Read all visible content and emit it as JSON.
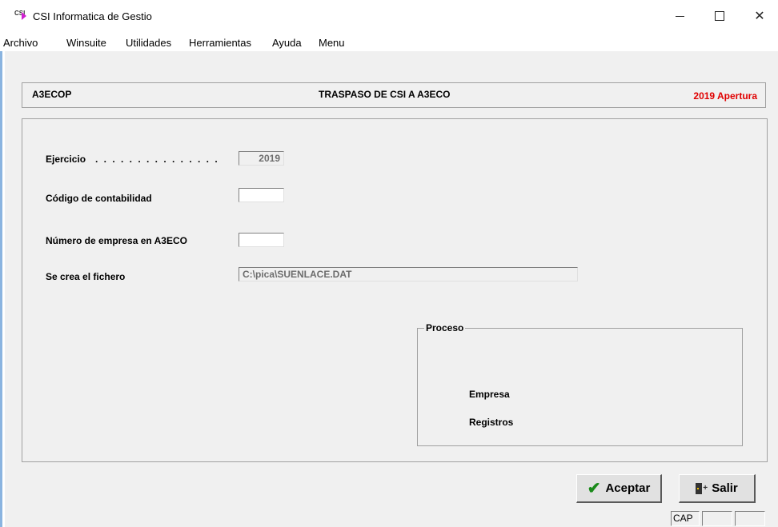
{
  "window": {
    "title": "CSI Informatica de Gestio",
    "icon_text": "CSI",
    "controls": [
      "minimize",
      "maximize",
      "close"
    ],
    "close_glyph": "✕"
  },
  "menu": {
    "items": [
      "Archivo",
      "Winsuite",
      "Utilidades",
      "Herramientas",
      "Ayuda",
      "Menu"
    ]
  },
  "header": {
    "code": "A3ECOP",
    "title": "TRASPASO DE CSI A A3ECO",
    "status": "2019 Apertura",
    "status_color": "#e00000"
  },
  "form": {
    "ejercicio": {
      "label": "Ejercicio",
      "dots": ". . . . . . . . . . . . . . .",
      "value": "2019"
    },
    "codigo_contabilidad": {
      "label": "Código de contabilidad",
      "value": ""
    },
    "numero_empresa": {
      "label": "Número de empresa en A3ECO",
      "value": ""
    },
    "fichero": {
      "label": "Se crea el fichero",
      "value": "C:\\pica\\SUENLACE.DAT"
    }
  },
  "proceso": {
    "title": "Proceso",
    "empresa_label": "Empresa",
    "registros_label": "Registros"
  },
  "buttons": {
    "aceptar": "Aceptar",
    "salir": "Salir"
  },
  "statusbar": {
    "cap": "CAP"
  }
}
